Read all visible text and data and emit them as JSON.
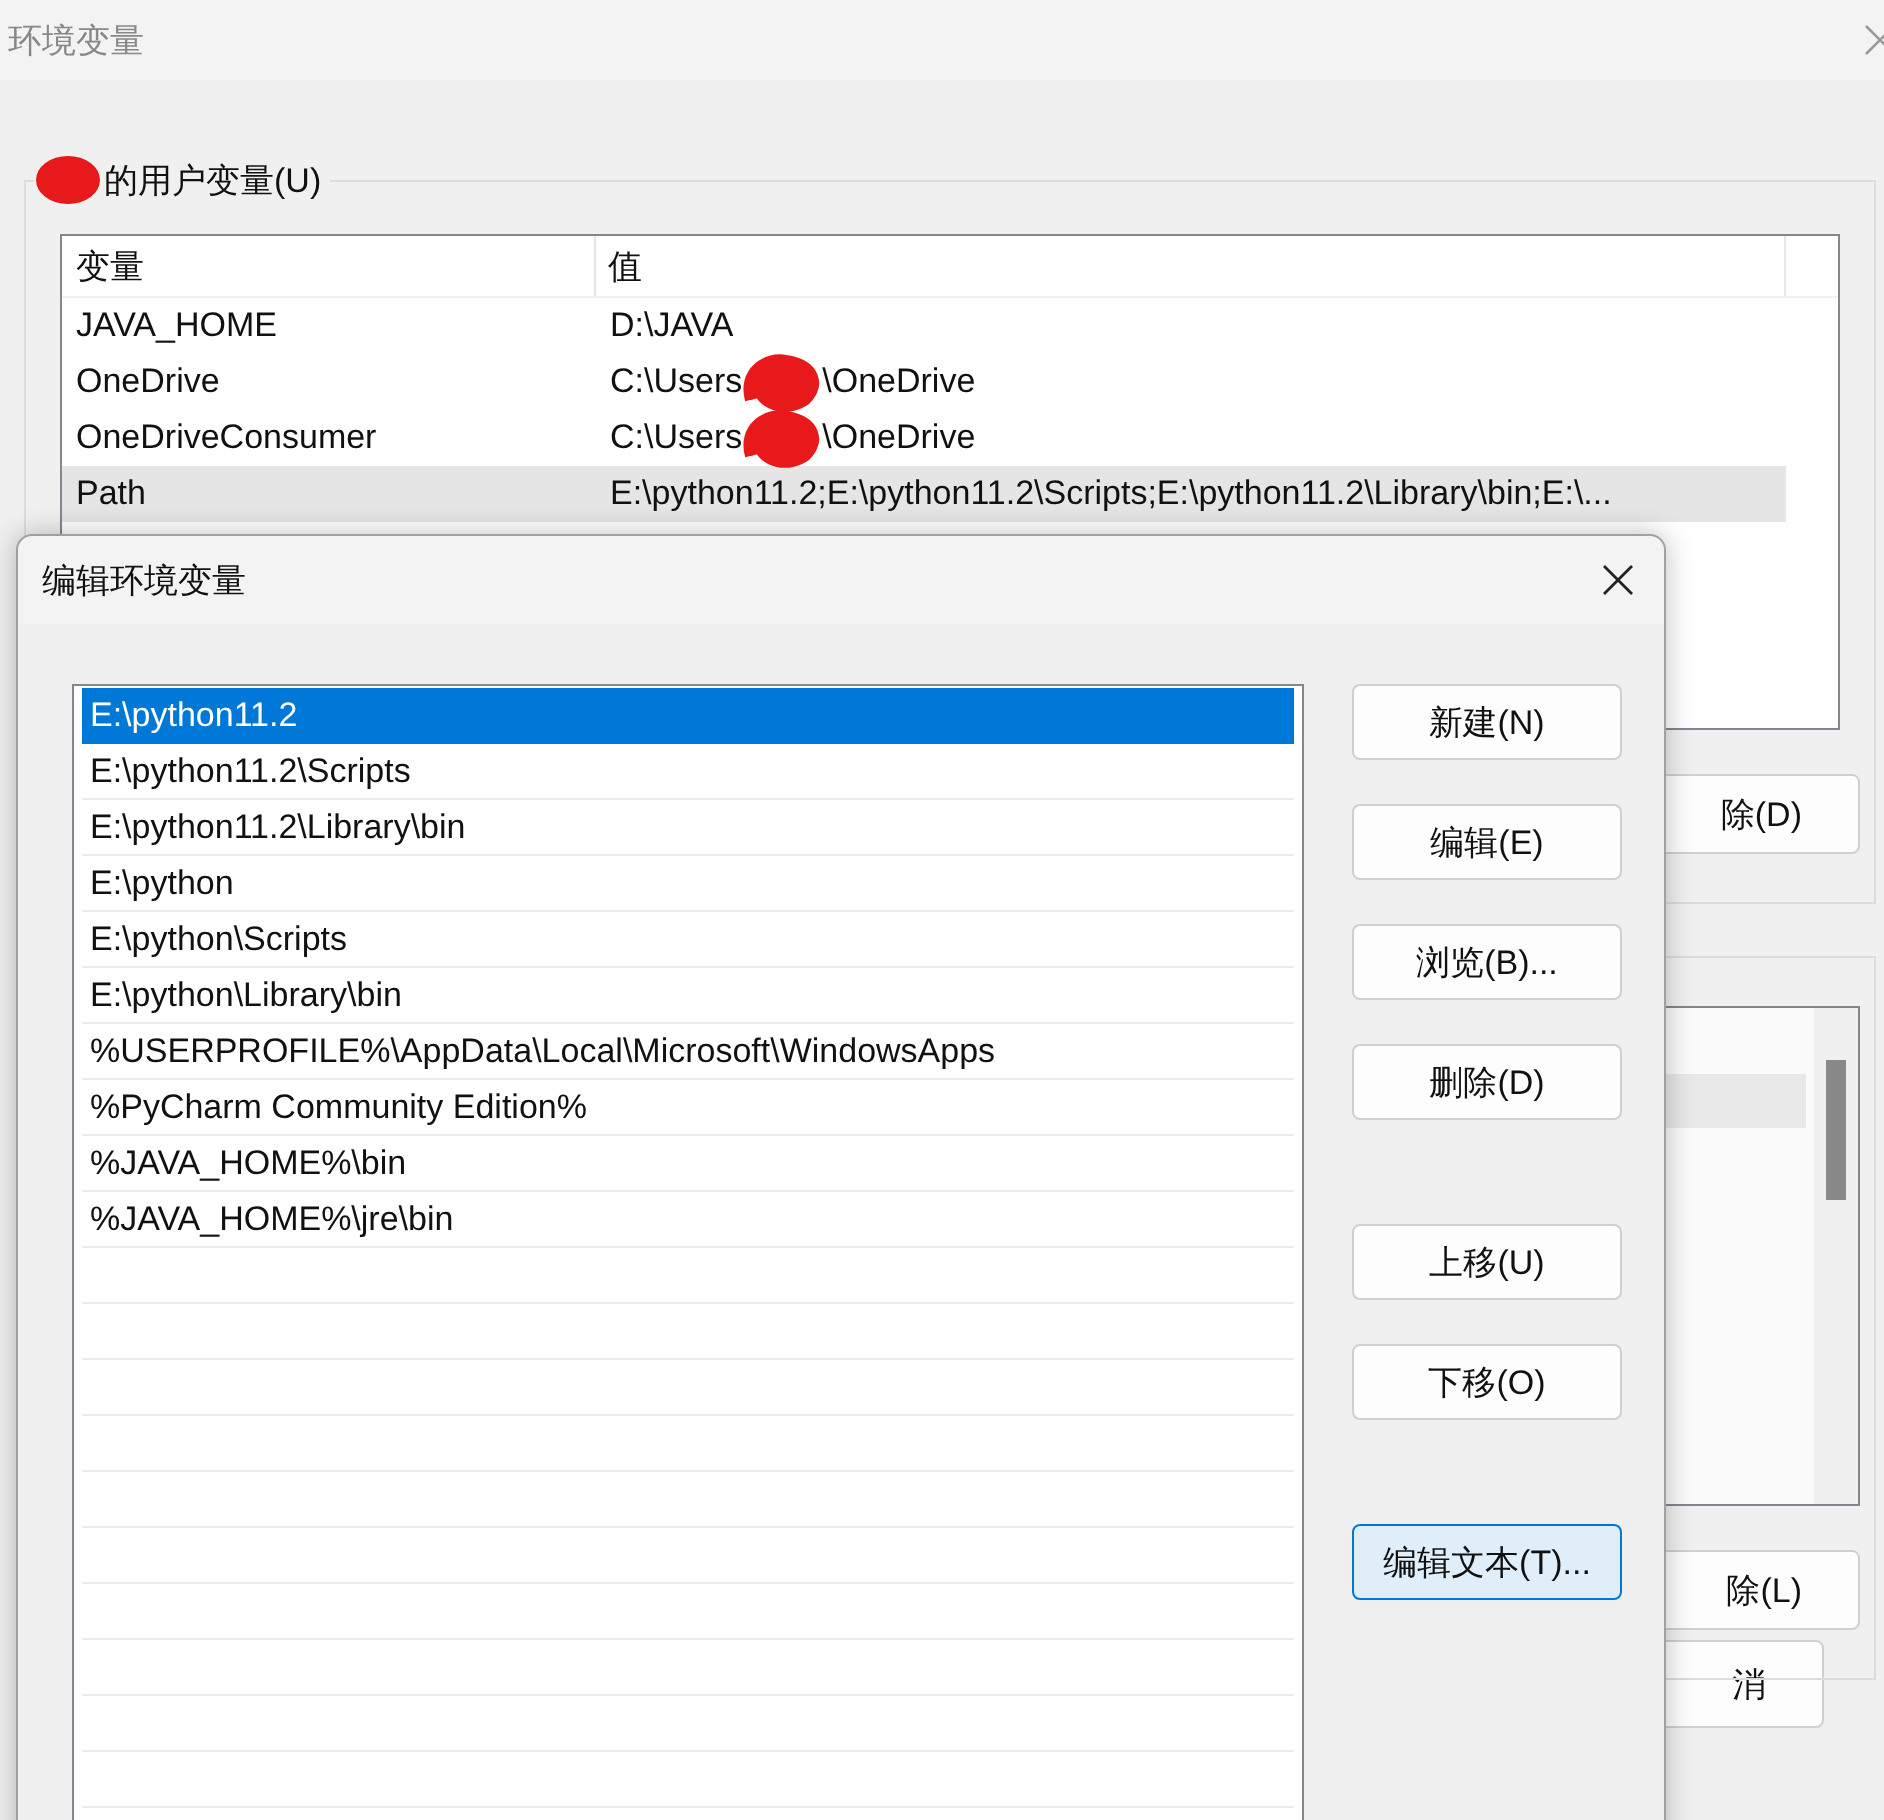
{
  "window": {
    "title": "环境变量"
  },
  "user_variables": {
    "label": "的用户变量(U)",
    "label_redacted": true,
    "columns": [
      "变量",
      "值"
    ],
    "rows": [
      {
        "name": "JAVA_HOME",
        "value": "D:\\JAVA",
        "redacted": false,
        "selected": false
      },
      {
        "name": "OneDrive",
        "value": "C:\\Users",
        "value_after": "\\OneDrive",
        "redacted": true,
        "selected": false
      },
      {
        "name": "OneDriveConsumer",
        "value": "C:\\Users",
        "value_after": "\\OneDrive",
        "redacted": true,
        "selected": false
      },
      {
        "name": "Path",
        "value": "E:\\python11.2;E:\\python11.2\\Scripts;E:\\python11.2\\Library\\bin;E:\\...",
        "redacted": false,
        "selected": true
      }
    ],
    "button": "除(D)"
  },
  "system_variables": {
    "button": "除(L)"
  },
  "cancel_button": "消",
  "dialog": {
    "title": "编辑环境变量",
    "entries": [
      {
        "text": "E:\\python11.2",
        "selected": true
      },
      {
        "text": "E:\\python11.2\\Scripts",
        "selected": false
      },
      {
        "text": "E:\\python11.2\\Library\\bin",
        "selected": false
      },
      {
        "text": "E:\\python",
        "selected": false
      },
      {
        "text": "E:\\python\\Scripts",
        "selected": false
      },
      {
        "text": "E:\\python\\Library\\bin",
        "selected": false
      },
      {
        "text": "%USERPROFILE%\\AppData\\Local\\Microsoft\\WindowsApps",
        "selected": false
      },
      {
        "text": "%PyCharm Community Edition%",
        "selected": false
      },
      {
        "text": "%JAVA_HOME%\\bin",
        "selected": false
      },
      {
        "text": "%JAVA_HOME%\\jre\\bin",
        "selected": false
      }
    ],
    "button_groups": [
      [
        {
          "label": "新建(N)",
          "default": false
        },
        {
          "label": "编辑(E)",
          "default": false
        },
        {
          "label": "浏览(B)...",
          "default": false
        },
        {
          "label": "删除(D)",
          "default": false
        }
      ],
      [
        {
          "label": "上移(U)",
          "default": false
        },
        {
          "label": "下移(O)",
          "default": false
        }
      ],
      [
        {
          "label": "编辑文本(T)...",
          "default": true
        }
      ]
    ]
  }
}
